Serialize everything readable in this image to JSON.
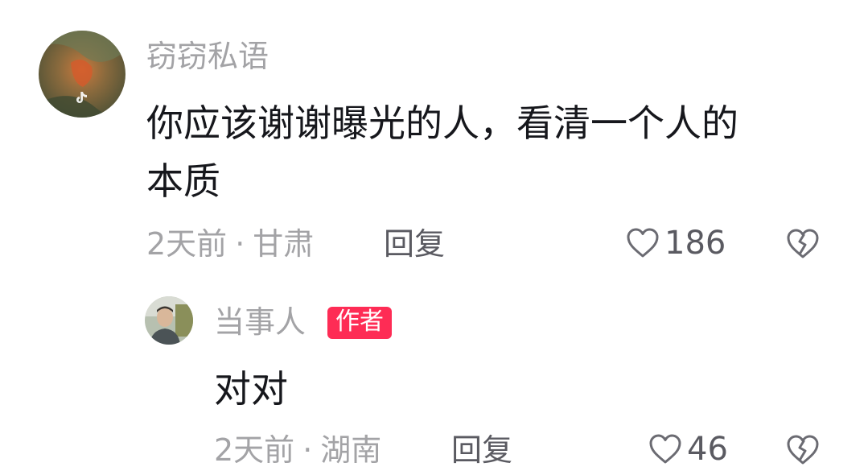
{
  "comment": {
    "username": "窃窃私语",
    "avatar_icon": "tiktok-avatar-landscape",
    "text_line1": "你应该谢谢曝光的人，看清一个人的",
    "text_line2": "本质",
    "time": "2天前",
    "separator": "·",
    "location": "甘肃",
    "reply_label": "回复",
    "like_count": "186",
    "like_icon": "heart-outline-icon",
    "dislike_icon": "broken-heart-icon"
  },
  "reply": {
    "username": "当事人",
    "badge": "作者",
    "badge_color": "#fe2c55",
    "avatar_icon": "person-avatar",
    "text": "对对",
    "time": "2天前",
    "separator": "·",
    "location": "湖南",
    "reply_label": "回复",
    "like_count": "46",
    "like_icon": "heart-outline-icon",
    "dislike_icon": "broken-heart-icon"
  }
}
